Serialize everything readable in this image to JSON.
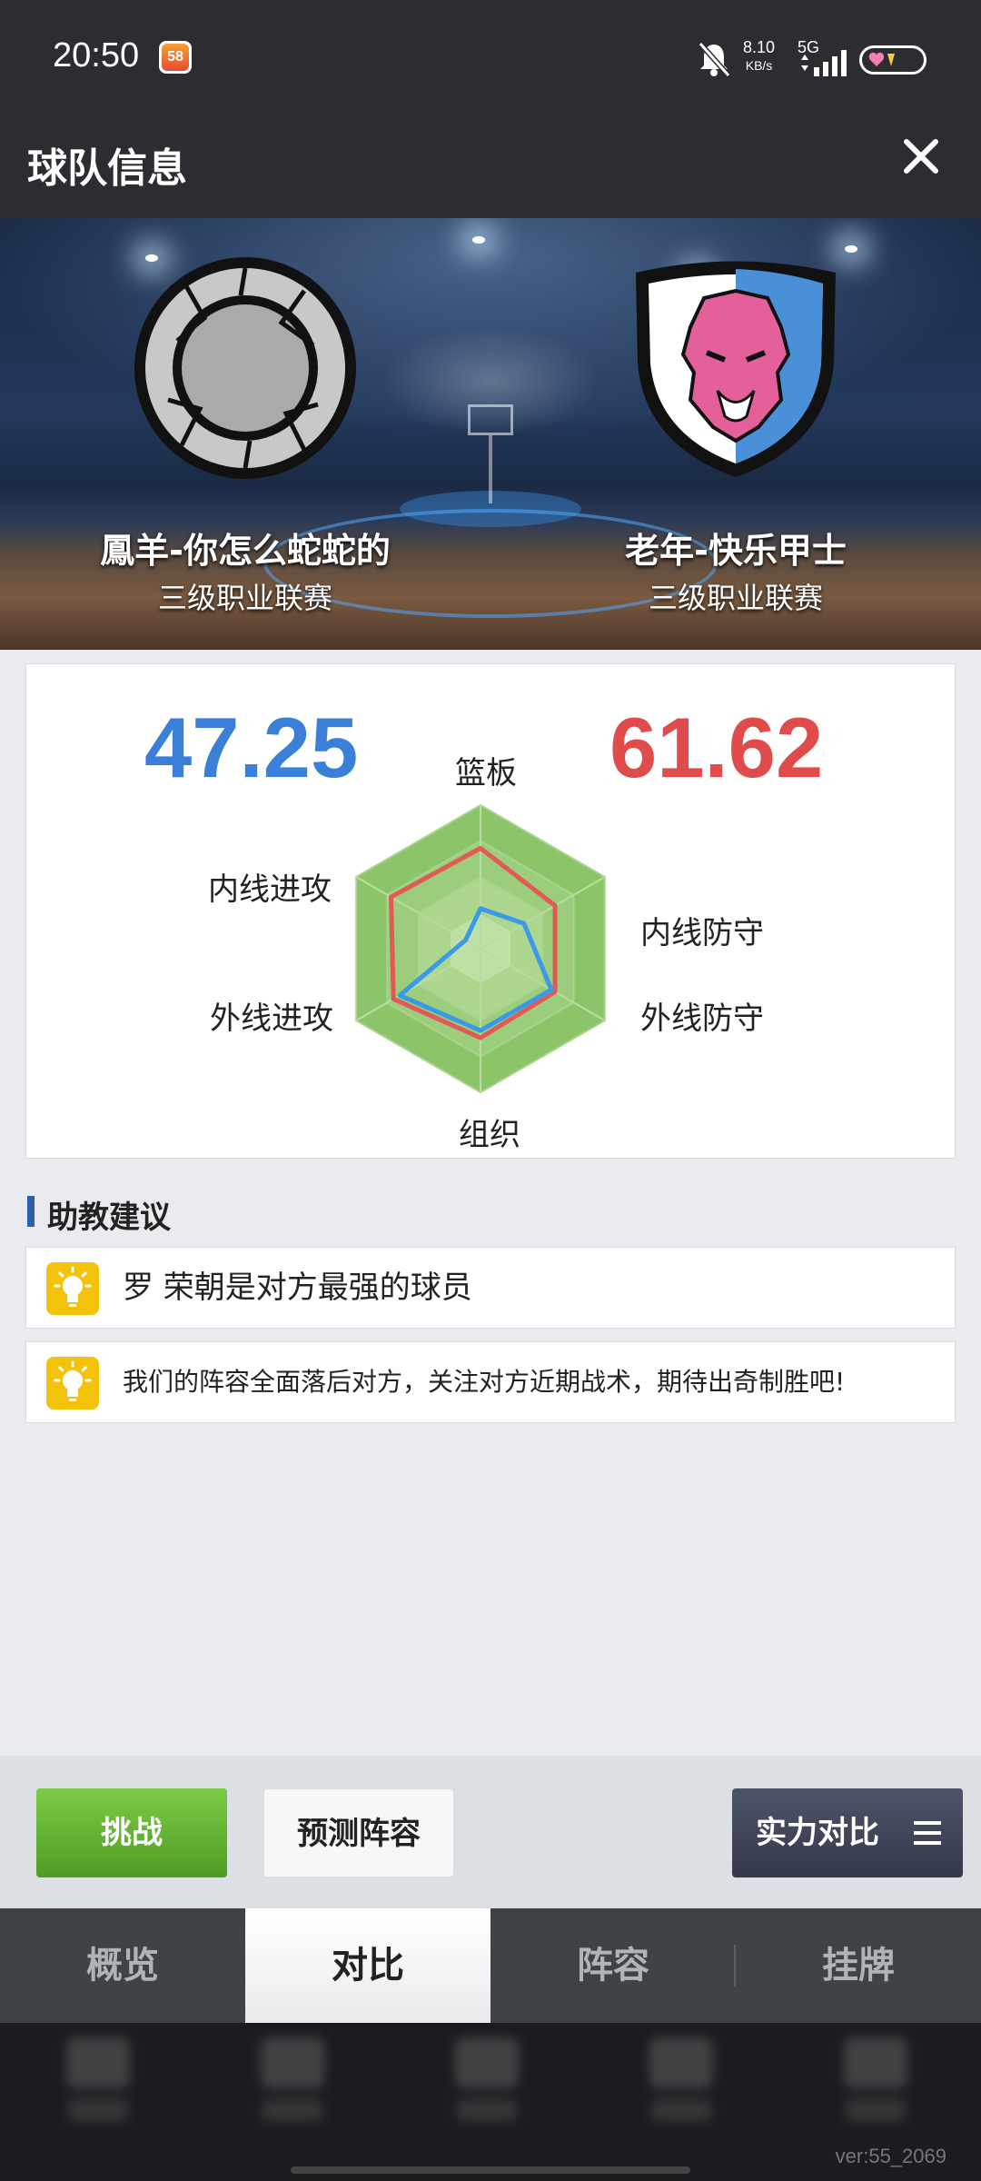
{
  "status_bar": {
    "time": "20:50",
    "app_badge": "58",
    "net_speed_value": "8.10",
    "net_speed_unit": "KB/s",
    "network": "5G",
    "icons": [
      "app-notification-icon",
      "bell-muted-icon",
      "signal-icon",
      "battery-icon"
    ]
  },
  "header": {
    "title": "球队信息",
    "close_icon": "close-icon"
  },
  "teams": {
    "left": {
      "name": "鳳羊-你怎么蛇蛇的",
      "league": "三级职业联赛",
      "logo": "shattered-ring-logo"
    },
    "right": {
      "name": "老年-快乐甲士",
      "league": "三级职业联赛",
      "logo": "wolf-shield-logo"
    }
  },
  "compare": {
    "left_score": "47.25",
    "right_score": "61.62",
    "axes": {
      "top": "篮板",
      "upper_right": "内线防守",
      "lower_right": "外线防守",
      "bottom": "组织",
      "lower_left": "外线进攻",
      "upper_left": "内线进攻"
    },
    "colors": {
      "left": "#3a9ae8",
      "right": "#e25a55",
      "radar_fill": "#8cc46a"
    }
  },
  "chart_data": {
    "type": "radar",
    "categories": [
      "篮板",
      "内线防守",
      "外线防守",
      "组织",
      "外线进攻",
      "内线进攻"
    ],
    "series": [
      {
        "values": [
          0.28,
          0.35,
          0.57,
          0.57,
          0.65,
          0.12
        ]
      },
      {
        "values": [
          0.7,
          0.6,
          0.6,
          0.62,
          0.7,
          0.72
        ]
      }
    ],
    "range": [
      0,
      1
    ]
  },
  "coach": {
    "title": "助教建议",
    "tips": [
      {
        "icon": "lightbulb-icon",
        "text": "罗 荣朝是对方最强的球员"
      },
      {
        "icon": "lightbulb-icon",
        "text": "我们的阵容全面落后对方，关注对方近期战术，期待出奇制胜吧!"
      }
    ]
  },
  "actions": {
    "challenge": "挑战",
    "predict": "预测阵容",
    "strength_compare": "实力对比",
    "menu_icon": "menu-icon"
  },
  "tabs": [
    {
      "label": "概览",
      "active": false
    },
    {
      "label": "对比",
      "active": true
    },
    {
      "label": "阵容",
      "active": false
    },
    {
      "label": "挂牌",
      "active": false
    }
  ],
  "version": "ver:55_2069"
}
